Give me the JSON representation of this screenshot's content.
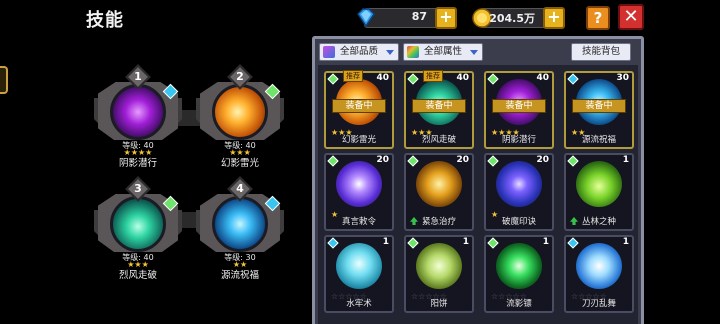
{
  "header": {
    "title": "技能"
  },
  "currency": {
    "gems": {
      "icon": "gem-icon",
      "value": "87"
    },
    "gold": {
      "icon": "gold-coin-icon",
      "value": "204.5万"
    }
  },
  "buttons": {
    "plus": "+",
    "help": "?",
    "close": "✕"
  },
  "equipped": [
    {
      "slot": "1",
      "level_text": "等级: 40",
      "stars": "★★★★",
      "name": "阴影潜行",
      "orb": "purple",
      "diamond_color": "#38c6f0"
    },
    {
      "slot": "2",
      "level_text": "等级: 40",
      "stars": "★★★",
      "name": "幻影雷光",
      "orb": "orange",
      "diamond_color": "#6ee56a"
    },
    {
      "slot": "3",
      "level_text": "等级: 40",
      "stars": "★★★",
      "name": "烈风走破",
      "orb": "teal",
      "diamond_color": "#6ee56a"
    },
    {
      "slot": "4",
      "level_text": "等级: 30",
      "stars": "★★",
      "name": "源流祝福",
      "orb": "cyan",
      "diamond_color": "#38c6f0"
    }
  ],
  "panel": {
    "filter_quality": "全部品质",
    "filter_attr": "全部属性",
    "bag_button": "技能背包",
    "cards": [
      {
        "name": "幻影雷光",
        "level": "40",
        "stars": "★★★",
        "equipped": "装备中",
        "recommended": "推荐",
        "orb": "orange",
        "diamond_color": "#6ee56a",
        "up": false
      },
      {
        "name": "烈风走破",
        "level": "40",
        "stars": "★★★",
        "equipped": "装备中",
        "recommended": "推荐",
        "orb": "teal",
        "diamond_color": "#6ee56a",
        "up": false
      },
      {
        "name": "阴影潜行",
        "level": "40",
        "stars": "★★★★",
        "equipped": "装备中",
        "recommended": "",
        "orb": "purple",
        "diamond_color": "#6ee56a",
        "up": false
      },
      {
        "name": "源流祝福",
        "level": "30",
        "stars": "★★",
        "equipped": "装备中",
        "recommended": "",
        "orb": "cyan",
        "diamond_color": "#38c6f0",
        "up": false
      },
      {
        "name": "真言敕令",
        "level": "20",
        "stars": "★",
        "equipped": "",
        "recommended": "",
        "orb": "violet",
        "diamond_color": "#6ee56a",
        "up": false
      },
      {
        "name": "紧急治疗",
        "level": "20",
        "stars": "",
        "equipped": "",
        "recommended": "",
        "orb": "gold",
        "diamond_color": "#6ee56a",
        "up": true
      },
      {
        "name": "破魔印诀",
        "level": "20",
        "stars": "★",
        "equipped": "",
        "recommended": "",
        "orb": "blue",
        "diamond_color": "#6ee56a",
        "up": false
      },
      {
        "name": "丛林之种",
        "level": "1",
        "stars": "",
        "equipped": "",
        "recommended": "",
        "orb": "green",
        "diamond_color": "#6ee56a",
        "up": true
      },
      {
        "name": "水牢术",
        "level": "1",
        "stars": "☆☆☆☆☆",
        "equipped": "",
        "recommended": "",
        "orb": "aqua",
        "diamond_color": "#38c6f0",
        "up": false
      },
      {
        "name": "阳饼",
        "level": "1",
        "stars": "☆☆☆☆☆",
        "equipped": "",
        "recommended": "",
        "orb": "lime",
        "diamond_color": "#6ee56a",
        "up": false
      },
      {
        "name": "流影镖",
        "level": "1",
        "stars": "☆☆☆☆☆",
        "equipped": "",
        "recommended": "",
        "orb": "shuriken",
        "diamond_color": "#6ee56a",
        "up": false
      },
      {
        "name": "刀刃乱舞",
        "level": "1",
        "stars": "☆☆☆☆☆",
        "equipped": "",
        "recommended": "",
        "orb": "blades",
        "diamond_color": "#38c6f0",
        "up": false
      }
    ]
  },
  "colors": {
    "accent_gold": "#e6b21d",
    "close_red": "#d33030",
    "help_orange": "#e98e1f",
    "panel_border": "#8b8fa3"
  }
}
